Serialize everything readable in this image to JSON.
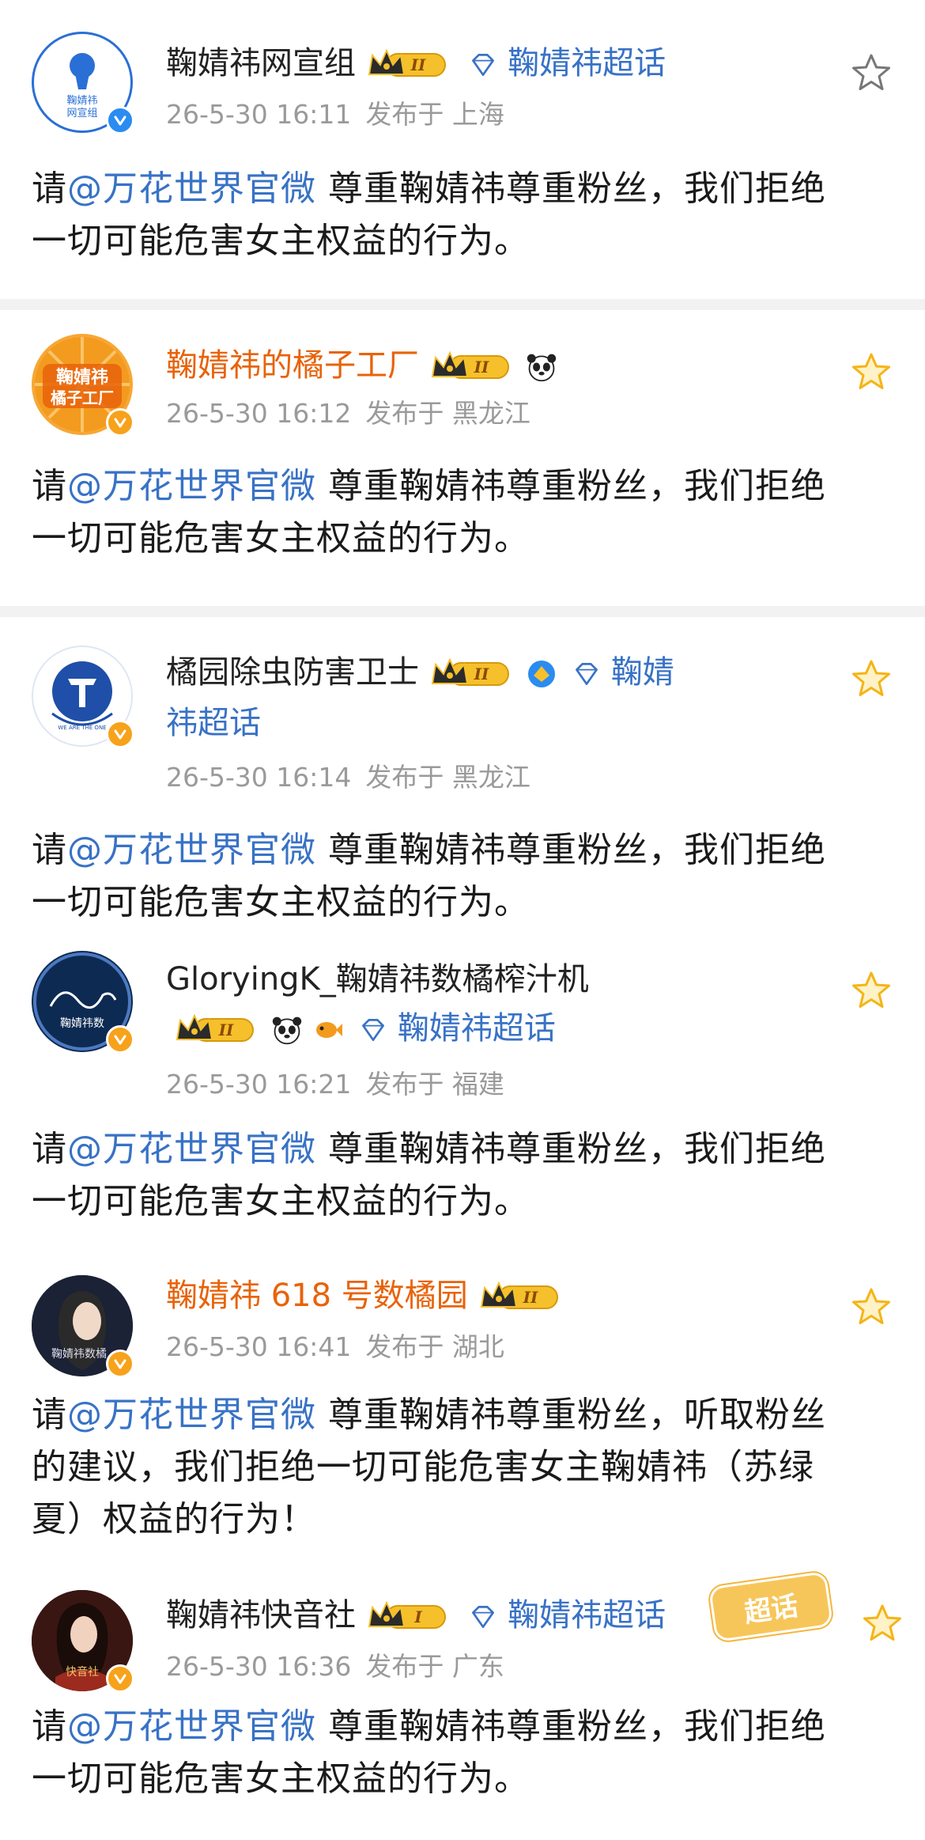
{
  "colors": {
    "mention": "#3872c6",
    "orange_name": "#e8630a",
    "meta": "#9a9a9a",
    "star_outline": "#777777",
    "star_gold": "#f5b417"
  },
  "posts": [
    {
      "name": "鞠婧祎网宣组",
      "crown_level": "II",
      "topic": "鞠婧祎超话",
      "time": "26-5-30 16:11",
      "location": "发布于 上海",
      "mention": "@万花世界官微",
      "line1_rest": " 尊重鞠婧祎尊重粉丝，我们拒绝",
      "line2": "一切可能危害女主权益的行为。",
      "avatar_text": "鞠婧祎网宣组",
      "star_icon": "star-outline-icon"
    },
    {
      "name": "鞠婧祎的橘子工厂",
      "crown_level": "II",
      "time": "26-5-30 16:12",
      "location": "发布于 黑龙江",
      "mention": "@万花世界官微",
      "line1_rest": " 尊重鞠婧祎尊重粉丝，我们拒绝",
      "line2": "一切可能危害女主权益的行为。",
      "avatar_text": "鞠婧祎橘子工厂",
      "star_icon": "star-gold-icon"
    },
    {
      "name": "橘园除虫防害卫士",
      "crown_level": "II",
      "topic_a": "鞠婧",
      "topic_b": "祎超话",
      "time": "26-5-30 16:14",
      "location": "发布于 黑龙江",
      "mention": "@万花世界官微",
      "line1_rest": " 尊重鞠婧祎尊重粉丝，我们拒绝",
      "line2": "一切可能危害女主权益的行为。",
      "avatar_text": "WE ARE THE ONE",
      "star_icon": "star-gold-icon"
    },
    {
      "name": "GloryingK_鞠婧祎数橘榨汁机",
      "crown_level": "II",
      "topic": "鞠婧祎超话",
      "time": "26-5-30 16:21",
      "location": "发布于 福建",
      "mention": "@万花世界官微",
      "line1_rest": " 尊重鞠婧祎尊重粉丝，我们拒绝",
      "line2": "一切可能危害女主权益的行为。",
      "avatar_text": "鞠婧祎数",
      "star_icon": "star-gold-icon"
    },
    {
      "name": "鞠婧祎 618 号数橘园",
      "crown_level": "II",
      "time": "26-5-30 16:41",
      "location": "发布于 湖北",
      "mention": "@万花世界官微",
      "line1_rest": " 尊重鞠婧祎尊重粉丝，听取粉丝",
      "line2": "的建议，我们拒绝一切可能危害女主鞠婧祎（苏绿",
      "line3": "夏）权益的行为！",
      "avatar_text": "鞠婧祎数橘",
      "star_icon": "star-gold-icon"
    },
    {
      "name": "鞠婧祎快音社",
      "crown_level": "I",
      "topic": "鞠婧祎超话",
      "sticker": "超话",
      "time": "26-5-30 16:36",
      "location": "发布于 广东",
      "mention": "@万花世界官微",
      "line1_rest": " 尊重鞠婧祎尊重粉丝，我们拒绝",
      "line2": "一切可能危害女主权益的行为。",
      "avatar_text": "快音社",
      "star_icon": "star-gold-icon"
    }
  ]
}
